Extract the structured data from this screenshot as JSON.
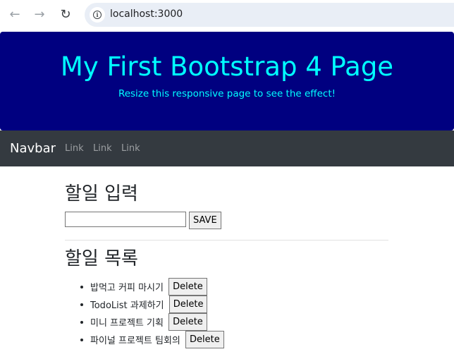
{
  "browser": {
    "url": "localhost:3000",
    "back_icon": "←",
    "forward_icon": "→",
    "reload_icon": "↻",
    "info_icon": "i"
  },
  "jumbotron": {
    "title": "My First Bootstrap 4 Page",
    "subtitle": "Resize this responsive page to see the effect!",
    "background_color": "#000080",
    "text_color": "#00ffff"
  },
  "navbar": {
    "brand": "Navbar",
    "links": [
      "Link",
      "Link",
      "Link"
    ],
    "background_color": "#343a40"
  },
  "todo_input_section": {
    "heading": "할일 입력",
    "input_value": "",
    "save_label": "SAVE"
  },
  "todo_list_section": {
    "heading": "할일 목록",
    "items": [
      {
        "text": "밥먹고 커피 마시기",
        "delete_label": "Delete"
      },
      {
        "text": "TodoList 과제하기",
        "delete_label": "Delete"
      },
      {
        "text": "미니 프로젝트 기획",
        "delete_label": "Delete"
      },
      {
        "text": "파이널 프로젝트 팀회의",
        "delete_label": "Delete"
      }
    ]
  }
}
